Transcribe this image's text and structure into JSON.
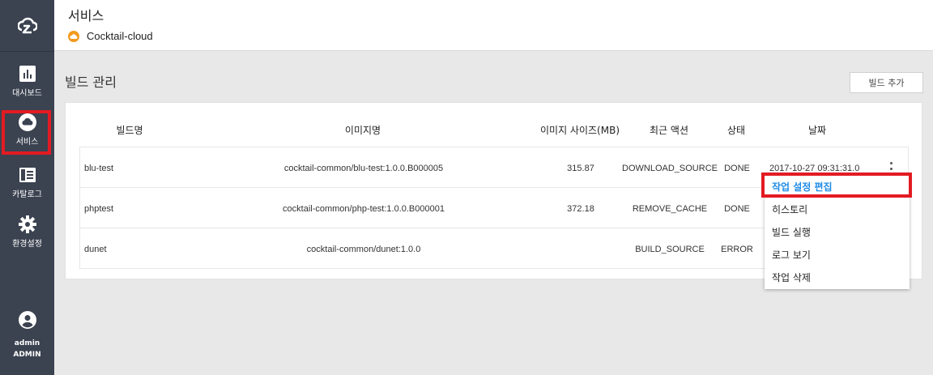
{
  "sidebar": {
    "logo_icon": "cloud-logo-icon",
    "items": [
      {
        "label": "대시보드",
        "icon": "dashboard-icon"
      },
      {
        "label": "서비스",
        "icon": "cloud-icon"
      },
      {
        "label": "카탈로그",
        "icon": "catalog-icon"
      },
      {
        "label": "환경설정",
        "icon": "gear-icon"
      }
    ],
    "user": {
      "name": "admin",
      "role": "ADMIN",
      "icon": "user-icon"
    }
  },
  "header": {
    "title": "서비스",
    "service_name": "Cocktail-cloud",
    "service_icon": "cloud-badge-icon",
    "service_color": "#f39a1e"
  },
  "section": {
    "title": "빌드 관리",
    "add_button": "빌드 추가"
  },
  "table": {
    "columns": [
      "빌드명",
      "이미지명",
      "이미지 사이즈(MB)",
      "최근 액션",
      "상태",
      "날짜"
    ],
    "rows": [
      {
        "name": "blu-test",
        "image": "cocktail-common/blu-test:1.0.0.B000005",
        "size": "315.87",
        "action": "DOWNLOAD_SOURCE",
        "status": "DONE",
        "date": "2017-10-27 09:31:31.0"
      },
      {
        "name": "phptest",
        "image": "cocktail-common/php-test:1.0.0.B000001",
        "size": "372.18",
        "action": "REMOVE_CACHE",
        "status": "DONE",
        "date": ""
      },
      {
        "name": "dunet",
        "image": "cocktail-common/dunet:1.0.0",
        "size": "",
        "action": "BUILD_SOURCE",
        "status": "ERROR",
        "date": ""
      }
    ]
  },
  "menu": {
    "items": [
      "작업 설정 편집",
      "히스토리",
      "빌드 실행",
      "로그 보기",
      "작업 삭제"
    ],
    "active_index": 0,
    "active_color": "#1f8ce6"
  },
  "colors": {
    "sidebar": "#3b4250",
    "highlight": "#e31b23",
    "background": "#e8e8e8"
  }
}
